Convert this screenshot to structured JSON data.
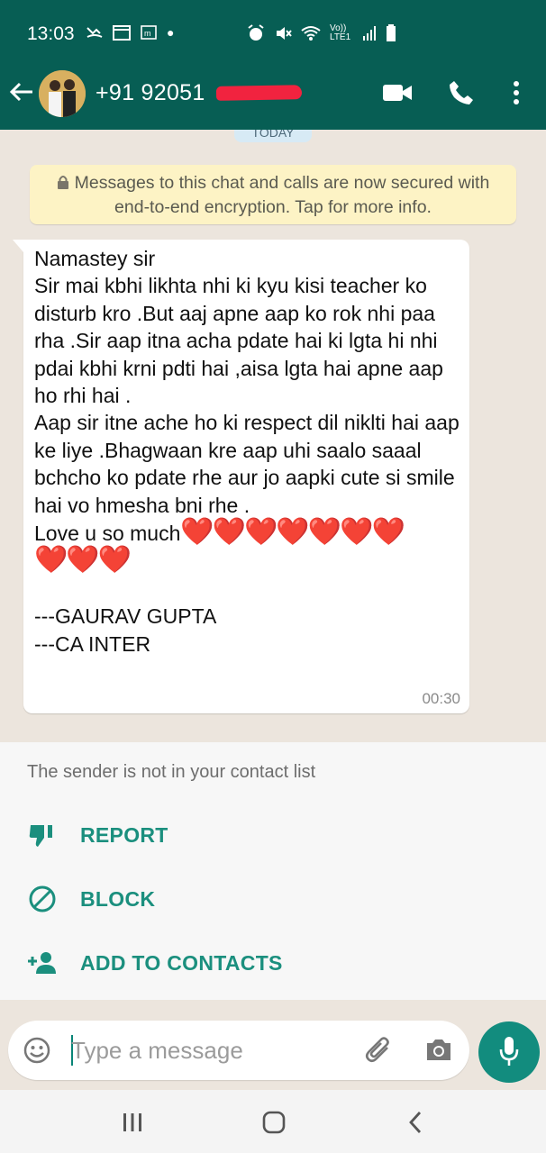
{
  "status_bar": {
    "time": "13:03",
    "network": "Vo)) LTE1"
  },
  "header": {
    "contact_number": "+91 92051",
    "icons": [
      "back-arrow-icon",
      "video-call-icon",
      "phone-icon",
      "more-vertical-icon"
    ]
  },
  "chat": {
    "day_chip": "TODAY",
    "encryption_notice": "Messages to this chat and calls are now secured with end-to-end encryption. Tap for more info.",
    "message": {
      "text": "Namastey sir\nSir mai kbhi likhta nhi ki kyu kisi teacher ko disturb kro .But aaj apne aap ko rok nhi paa rha .Sir aap itna acha pdate hai ki lgta hi nhi pdai kbhi krni pdti hai ,aisa lgta hai apne aap ho rhi hai .\nAap sir itne ache ho ki respect dil niklti hai aap ke liye .Bhagwaan kre aap uhi saalo saaal bchcho ko pdate rhe aur jo aapki cute si smile hai vo hmesha bni rhe .",
      "love_line": "Love u so much",
      "hearts_line1": "❤️❤️❤️❤️❤️❤️❤️",
      "hearts_line2": "❤️❤️❤️",
      "signature_1": "---GAURAV GUPTA",
      "signature_2": "---CA INTER",
      "time": "00:30"
    }
  },
  "unknown_sender_sheet": {
    "info": "The sender is not in your contact list",
    "report": "REPORT",
    "block": "BLOCK",
    "add_to_contacts": "ADD TO CONTACTS"
  },
  "composer": {
    "placeholder": "Type a message"
  },
  "colors": {
    "header": "#075e54",
    "accent": "#128c7e",
    "chat_bg": "#ece5dd",
    "encryption_bg": "#fdf3c5"
  }
}
